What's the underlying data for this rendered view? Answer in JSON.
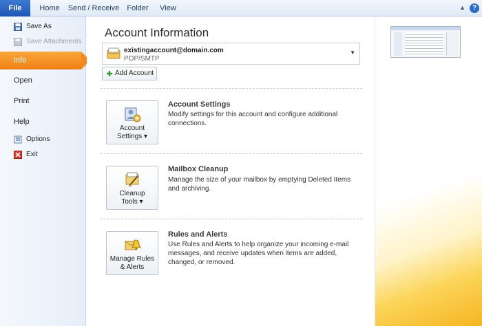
{
  "ribbon": {
    "tabs": [
      "File",
      "Home",
      "Send / Receive",
      "Folder",
      "View"
    ],
    "help_label": "?"
  },
  "nav": {
    "save_as": "Save As",
    "save_attachments": "Save Attachments",
    "info": "Info",
    "open": "Open",
    "print": "Print",
    "help": "Help",
    "options": "Options",
    "exit": "Exit"
  },
  "main": {
    "title": "Account Information",
    "account": {
      "email": "existingaccount@domain.com",
      "type": "POP/SMTP"
    },
    "add_account": "Add Account",
    "sections": [
      {
        "button_line1": "Account",
        "button_line2": "Settings ▾",
        "title": "Account Settings",
        "description": "Modify settings for this account and configure additional connections."
      },
      {
        "button_line1": "Cleanup",
        "button_line2": "Tools ▾",
        "title": "Mailbox Cleanup",
        "description": "Manage the size of your mailbox by emptying Deleted Items and archiving."
      },
      {
        "button_line1": "Manage Rules",
        "button_line2": "& Alerts",
        "title": "Rules and Alerts",
        "description": "Use Rules and Alerts to help organize your incoming e-mail messages, and receive updates when items are added, changed, or removed."
      }
    ]
  },
  "colors": {
    "accent_file": "#2a62c0",
    "selected_nav": "#f28a1f",
    "gold_swoosh": "#f6b521"
  }
}
